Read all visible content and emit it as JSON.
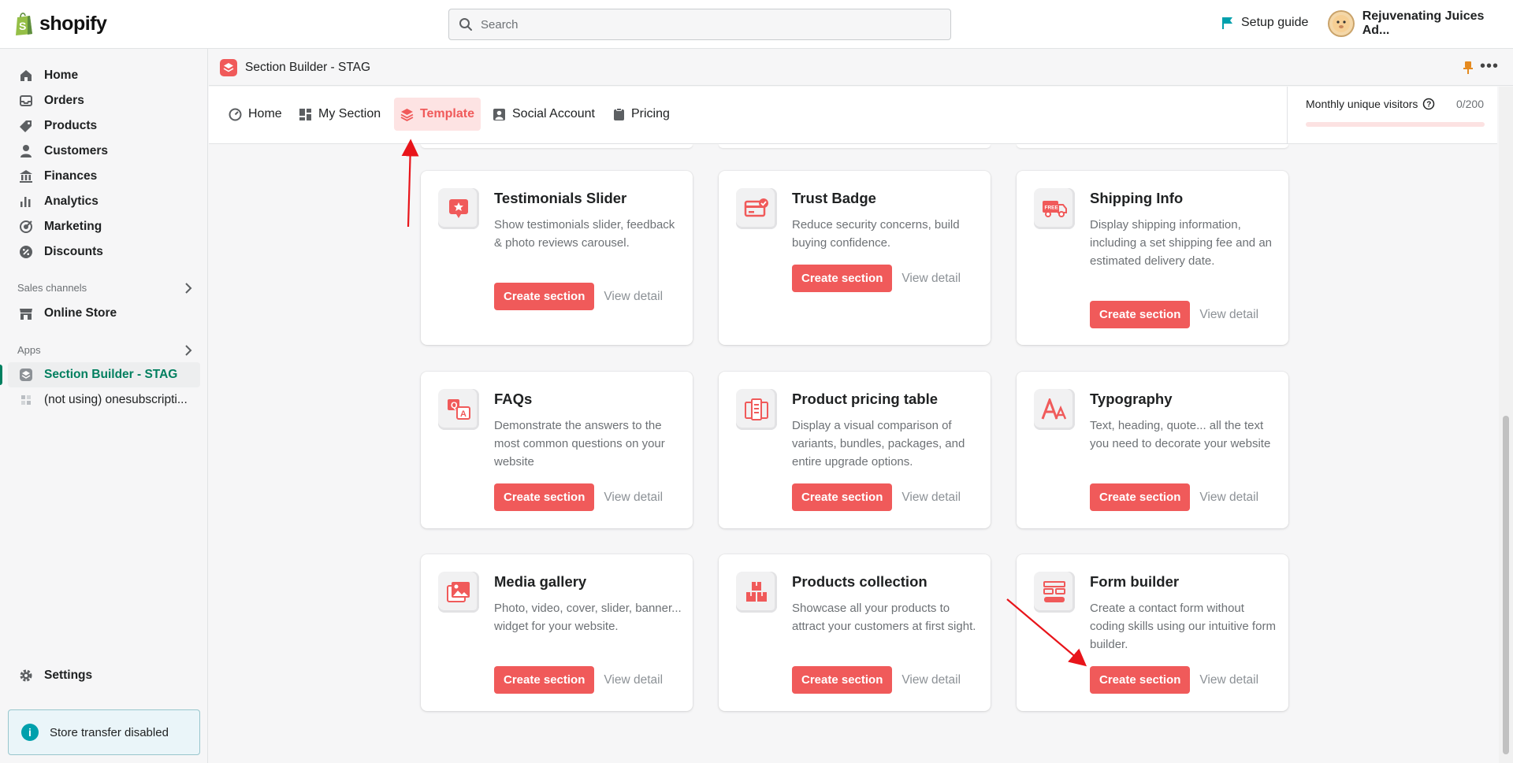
{
  "topbar": {
    "brand": "shopify",
    "search_placeholder": "Search",
    "setup_guide": "Setup guide",
    "store_name": "Rejuvenating Juices Ad..."
  },
  "sidebar": {
    "items": [
      {
        "label": "Home",
        "icon": "home-icon"
      },
      {
        "label": "Orders",
        "icon": "orders-icon"
      },
      {
        "label": "Products",
        "icon": "tag-icon"
      },
      {
        "label": "Customers",
        "icon": "person-icon"
      },
      {
        "label": "Finances",
        "icon": "bank-icon"
      },
      {
        "label": "Analytics",
        "icon": "bar-chart-icon"
      },
      {
        "label": "Marketing",
        "icon": "target-icon"
      },
      {
        "label": "Discounts",
        "icon": "percent-icon"
      }
    ],
    "sales_channels_label": "Sales channels",
    "online_store": "Online Store",
    "apps_label": "Apps",
    "apps": [
      {
        "label": "Section Builder - STAG",
        "active": true
      },
      {
        "label": "(not using) onesubscripti..."
      }
    ],
    "settings": "Settings",
    "transfer_notice": "Store transfer disabled"
  },
  "app": {
    "title": "Section Builder - STAG",
    "tabs": [
      {
        "label": "Home",
        "icon": "gauge-icon"
      },
      {
        "label": "My Section",
        "icon": "grid-icon"
      },
      {
        "label": "Template",
        "icon": "layers-icon",
        "active": true
      },
      {
        "label": "Social Account",
        "icon": "account-icon"
      },
      {
        "label": "Pricing",
        "icon": "clipboard-icon"
      }
    ],
    "visitors_label": "Monthly unique visitors",
    "visitors_count": "0/200",
    "visitors_fraction": 0.0
  },
  "cards": [
    {
      "title": "Testimonials Slider",
      "desc": "Show testimonials slider, feedback & photo reviews carousel.",
      "icon": "testimonial-star-icon",
      "create": "Create section",
      "view": "View detail"
    },
    {
      "title": "Trust Badge",
      "desc": "Reduce security concerns, build buying confidence.",
      "icon": "trust-badge-icon",
      "create": "Create section",
      "view": "View detail"
    },
    {
      "title": "Shipping Info",
      "desc": "Display shipping information, including a set shipping fee and an estimated delivery date.",
      "icon": "free-shipping-truck-icon",
      "create": "Create section",
      "view": "View detail"
    },
    {
      "title": "FAQs",
      "desc": "Demonstrate the answers to the most common questions on your website",
      "icon": "faq-icon",
      "create": "Create section",
      "view": "View detail"
    },
    {
      "title": "Product pricing table",
      "desc": "Display a visual comparison of variants, bundles, packages, and entire upgrade options.",
      "icon": "pricing-table-icon",
      "create": "Create section",
      "view": "View detail"
    },
    {
      "title": "Typography",
      "desc": "Text, heading, quote... all the text you need to decorate your website",
      "icon": "typography-icon",
      "create": "Create section",
      "view": "View detail"
    },
    {
      "title": "Media gallery",
      "desc": "Photo, video, cover, slider, banner... widget for your website.",
      "icon": "media-gallery-icon",
      "create": "Create section",
      "view": "View detail"
    },
    {
      "title": "Products collection",
      "desc": "Showcase all your products to attract your customers at first sight.",
      "icon": "boxes-icon",
      "create": "Create section",
      "view": "View detail"
    },
    {
      "title": "Form builder",
      "desc": "Create a contact form without coding skills using our intuitive form builder.",
      "icon": "form-icon",
      "create": "Create section",
      "view": "View detail"
    }
  ],
  "colors": {
    "accent": "#f05a5a",
    "accent_light": "#fde3e3",
    "shopify_green": "#008060",
    "annotation_arrow": "#e8141a"
  }
}
